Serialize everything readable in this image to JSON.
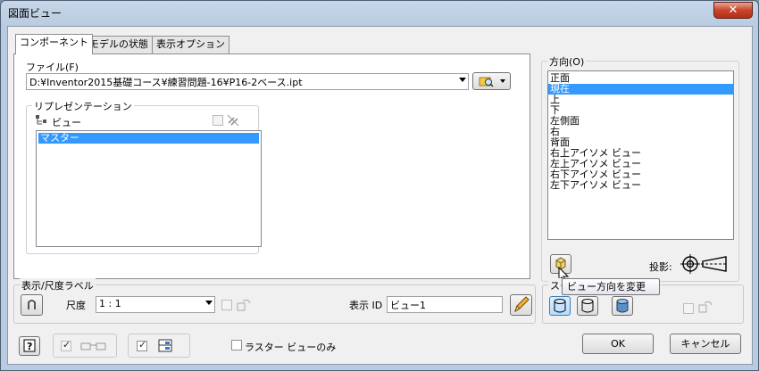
{
  "window": {
    "title": "図面ビュー",
    "close_label": "✕"
  },
  "tabs": [
    {
      "label": "コンポーネント",
      "active": true
    },
    {
      "label": "モデルの状態",
      "active": false
    },
    {
      "label": "表示オプション",
      "active": false
    }
  ],
  "file": {
    "label": "ファイル(F)",
    "value": "D:¥Inventor2015基礎コース¥練習問題-16¥P16-2ベース.ipt"
  },
  "representation": {
    "group_title": "リプレゼンテーション",
    "view_label": "ビュー",
    "items": [
      "マスター"
    ],
    "selected": "マスター"
  },
  "orientation": {
    "group_title": "方向(O)",
    "items": [
      "正面",
      "現在",
      "上",
      "下",
      "左側面",
      "右",
      "背面",
      "右上アイソメ ビュー",
      "左上アイソメ ビュー",
      "右下アイソメ ビュー",
      "左下アイソメ ビュー"
    ],
    "selected": "現在",
    "projection_label": "投影:",
    "tooltip": "ビュー方向を変更"
  },
  "label_group": {
    "title": "表示/尺度ラベル",
    "scale_label": "尺度",
    "scale_value": "1 : 1",
    "display_id_label": "表示 ID",
    "display_id_value": "ビュー1"
  },
  "style": {
    "title": "スタ"
  },
  "footer": {
    "raster_label": "ラスター ビューのみ",
    "ok_label": "OK",
    "cancel_label": "キャンセル"
  },
  "colors": {
    "selection": "#3399ff",
    "close": "#c7452c"
  }
}
